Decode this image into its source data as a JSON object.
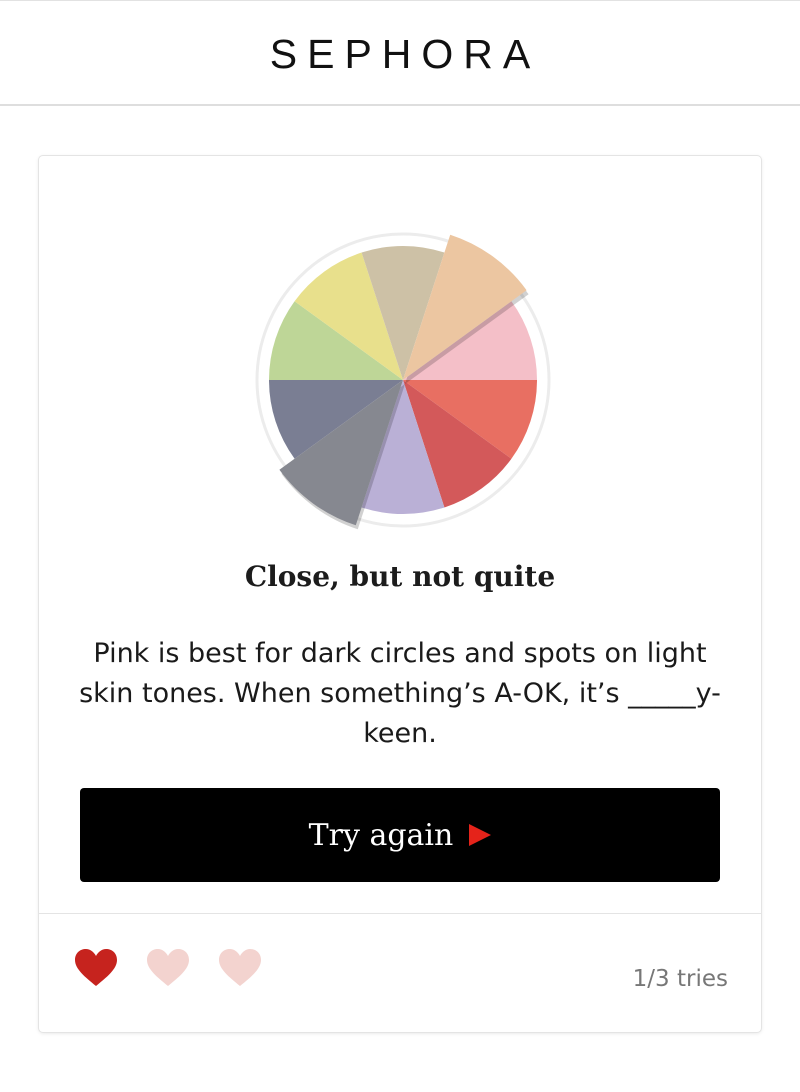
{
  "header": {
    "logo_text": "SEPHORA"
  },
  "quiz": {
    "wheel_colors": [
      "#f4bfc8",
      "#e86f62",
      "#d3595a",
      "#bab0d6",
      "#868890",
      "#7a7e93",
      "#bed697",
      "#e8e08c",
      "#cdc1a6",
      "#ecc6a1"
    ],
    "result_title": "Close, but not quite",
    "result_text": "Pink is best for dark circles and spots on light skin tones. When something’s A-OK, it’s _____y-keen.",
    "button_label": "Try again",
    "tries_text": "1/3 tries",
    "lives_total": 3,
    "lives_used": 1,
    "colors": {
      "heart_active": "#c6231e",
      "heart_inactive": "#f3d3cf",
      "play_arrow": "#e5231a"
    }
  }
}
